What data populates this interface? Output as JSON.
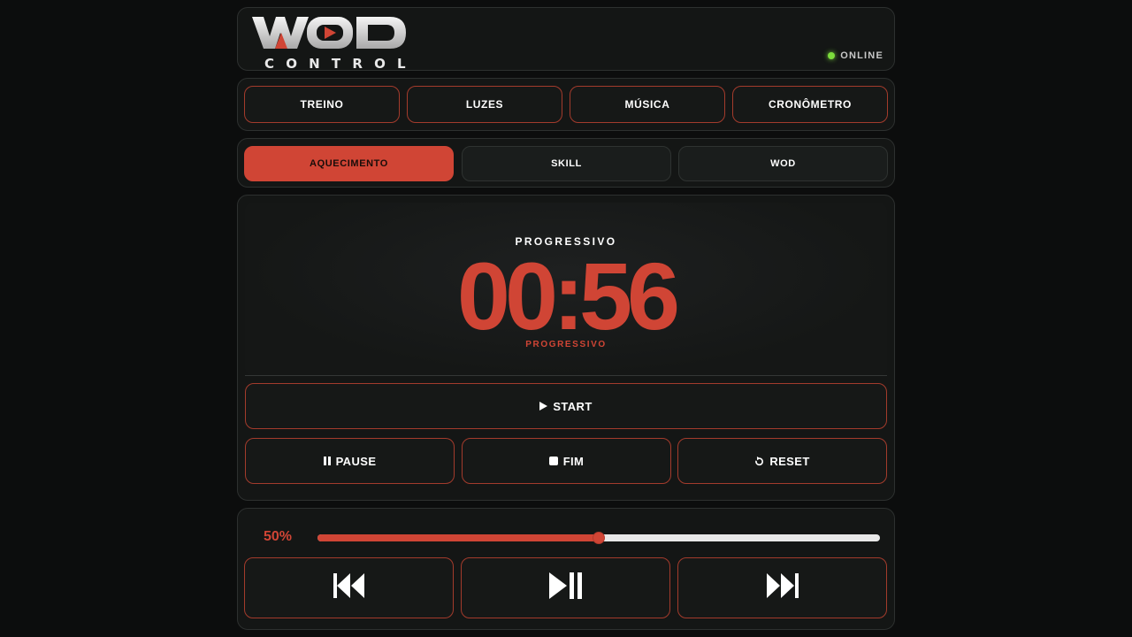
{
  "header": {
    "logo_text": "WOD",
    "logo_sub": "CONTROL",
    "status_text": "ONLINE",
    "status_color": "#7cdc3c"
  },
  "nav": {
    "items": [
      {
        "label": "TREINO"
      },
      {
        "label": "LUZES"
      },
      {
        "label": "MÚSICA"
      },
      {
        "label": "CRONÔMETRO"
      }
    ]
  },
  "phases": {
    "items": [
      {
        "label": "AQUECIMENTO",
        "active": true
      },
      {
        "label": "SKILL",
        "active": false
      },
      {
        "label": "WOD",
        "active": false
      }
    ]
  },
  "timer": {
    "mode_label": "PROGRESSIVO",
    "time": "00:56",
    "mode_sub": "PROGRESSIVO",
    "start_label": "START",
    "pause_label": "PAUSE",
    "fim_label": "FIM",
    "reset_label": "RESET",
    "start_icon": "play-icon",
    "pause_icon": "pause-icon",
    "fim_icon": "stop-icon",
    "reset_icon": "reset-icon"
  },
  "media": {
    "volume_label": "50%",
    "volume": 0.5,
    "prev_icon": "skip-back-icon",
    "play_pause_icon": "play-pause-icon",
    "next_icon": "skip-forward-icon"
  },
  "colors": {
    "accent": "#d04535",
    "background": "#0c0d0d",
    "panel": "#141615"
  }
}
